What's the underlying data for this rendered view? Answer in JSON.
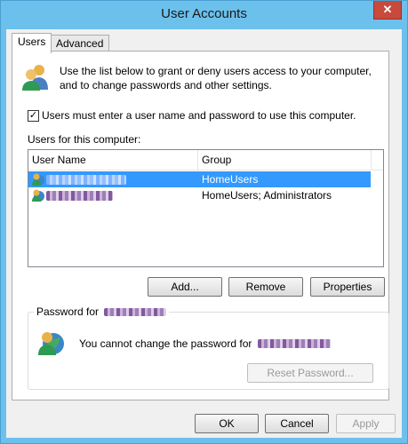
{
  "window": {
    "title": "User Accounts",
    "close_glyph": "✕"
  },
  "tabs": [
    {
      "label": "Users",
      "active": true
    },
    {
      "label": "Advanced",
      "active": false
    }
  ],
  "intro_text_line1": "Use the list below to grant or deny users access to your computer,",
  "intro_text_line2": "and to change passwords and other settings.",
  "require_password_checkbox": {
    "label": "Users must enter a user name and password to use this computer.",
    "checked": true,
    "check_glyph": "✓"
  },
  "users_label": "Users for this computer:",
  "user_list": {
    "columns": [
      "User Name",
      "Group"
    ],
    "rows": [
      {
        "user_name": "",
        "group": "HomeUsers",
        "selected": true
      },
      {
        "user_name": "",
        "group": "HomeUsers; Administrators",
        "selected": false
      }
    ]
  },
  "buttons": {
    "add": "Add...",
    "remove": "Remove",
    "properties": "Properties",
    "reset_password": "Reset Password...",
    "ok": "OK",
    "cancel": "Cancel",
    "apply": "Apply"
  },
  "password_group": {
    "legend": "Password for",
    "message": "You cannot change the password for"
  },
  "icons": {
    "users_icon": "users-icon",
    "user_globe_icon": "user-globe-icon"
  },
  "colors": {
    "title_bar": "#6cc0ec",
    "close_button": "#c74a3d",
    "selection": "#3399ff"
  }
}
